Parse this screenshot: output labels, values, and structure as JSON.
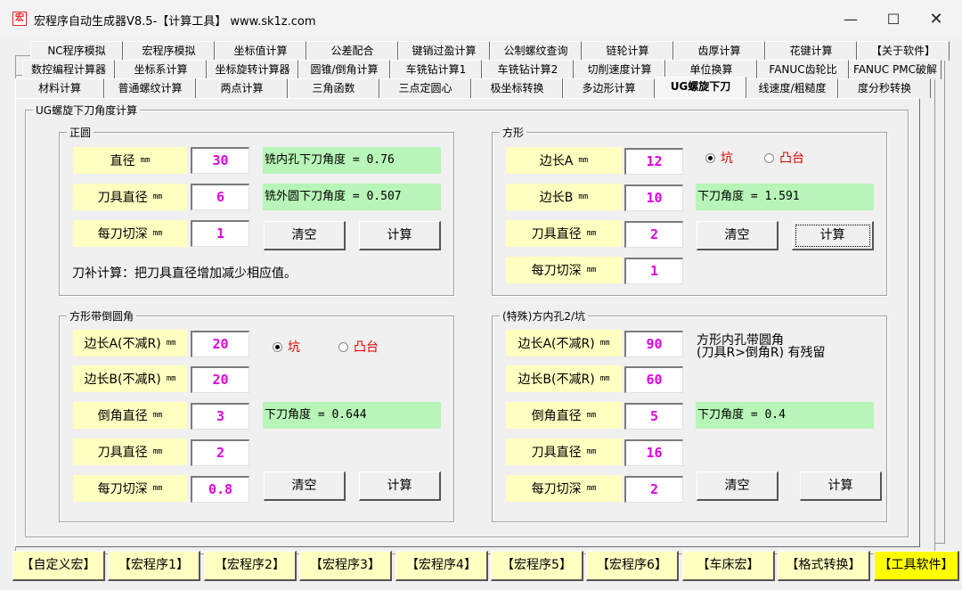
{
  "window": {
    "title": "宏程序自动生成器V8.5-【计算工具】   www.sk1z.com",
    "icon_text": "宏"
  },
  "tabs": {
    "row1": [
      "NC程序模拟",
      "宏程序模拟",
      "坐标值计算",
      "公差配合",
      "键销过盈计算",
      "公制螺纹查询",
      "链轮计算",
      "齿厚计算",
      "花键计算",
      "【关于软件】"
    ],
    "row2": [
      "数控编程计算器",
      "坐标系计算",
      "坐标旋转计算器",
      "圆锥/倒角计算",
      "车铣钻计算1",
      "车铣钻计算2",
      "切削速度计算",
      "单位换算",
      "FANUC齿轮比",
      "FANUC PMC破解"
    ],
    "row3": [
      "材料计算",
      "普通螺纹计算",
      "两点计算",
      "三角函数",
      "三点定圆心",
      "极坐标转换",
      "多边形计算",
      "UG螺旋下刀",
      "线速度/粗糙度",
      "度分秒转换"
    ],
    "active": "UG螺旋下刀"
  },
  "main": {
    "title": "UG螺旋下刀角度计算",
    "circle": {
      "title": "正圆",
      "fields": [
        {
          "label": "直径",
          "unit": "mm",
          "value": "30"
        },
        {
          "label": "刀具直径",
          "unit": "mm",
          "value": "6"
        },
        {
          "label": "每刀切深",
          "unit": "mm",
          "value": "1"
        }
      ],
      "result1": "铣内孔下刀角度 = 0.76",
      "result2": "铣外圆下刀角度 = 0.507",
      "clear": "清空",
      "calc": "计算",
      "note": "刀补计算：把刀具直径增加减少相应值。"
    },
    "square": {
      "title": "方形",
      "fields": [
        {
          "label": "边长A",
          "unit": "mm",
          "value": "12"
        },
        {
          "label": "边长B",
          "unit": "mm",
          "value": "10"
        },
        {
          "label": "刀具直径",
          "unit": "mm",
          "value": "2"
        },
        {
          "label": "每刀切深",
          "unit": "mm",
          "value": "1"
        }
      ],
      "radio1": "坑",
      "radio2": "凸台",
      "result": "下刀角度 = 1.591",
      "clear": "清空",
      "calc": "计算"
    },
    "chamfer": {
      "title": "方形带倒圆角",
      "fields": [
        {
          "label": "边长A(不减R)",
          "unit": "mm",
          "value": "20"
        },
        {
          "label": "边长B(不减R)",
          "unit": "mm",
          "value": "20"
        },
        {
          "label": "倒角直径",
          "unit": "mm",
          "value": "3"
        },
        {
          "label": "刀具直径",
          "unit": "mm",
          "value": "2"
        },
        {
          "label": "每刀切深",
          "unit": "mm",
          "value": "0.8"
        }
      ],
      "radio1": "坑",
      "radio2": "凸台",
      "result": "下刀角度 = 0.644",
      "clear": "清空",
      "calc": "计算"
    },
    "special": {
      "title": "(特殊)方内孔2/坑",
      "fields": [
        {
          "label": "边长A(不减R)",
          "unit": "mm",
          "value": "90"
        },
        {
          "label": "边长B(不减R)",
          "unit": "mm",
          "value": "60"
        },
        {
          "label": "倒角直径",
          "unit": "mm",
          "value": "5"
        },
        {
          "label": "刀具直径",
          "unit": "mm",
          "value": "16"
        },
        {
          "label": "每刀切深",
          "unit": "mm",
          "value": "2"
        }
      ],
      "note1": "方形内孔带圆角",
      "note2": "(刀具R>倒角R) 有残留",
      "result": "下刀角度 = 0.4",
      "clear": "清空",
      "calc": "计算"
    }
  },
  "bottom": [
    "【自定义宏】",
    "【宏程序1】",
    "【宏程序2】",
    "【宏程序3】",
    "【宏程序4】",
    "【宏程序5】",
    "【宏程序6】",
    "【车床宏】",
    "【格式转换】",
    "【工具软件】"
  ],
  "colors": {
    "label_bg": "#ffffc0",
    "result_bg": "#b8f5b8",
    "value": "#e000e0",
    "radio_text": "#e00000",
    "bottom_active": "#ffff00"
  }
}
